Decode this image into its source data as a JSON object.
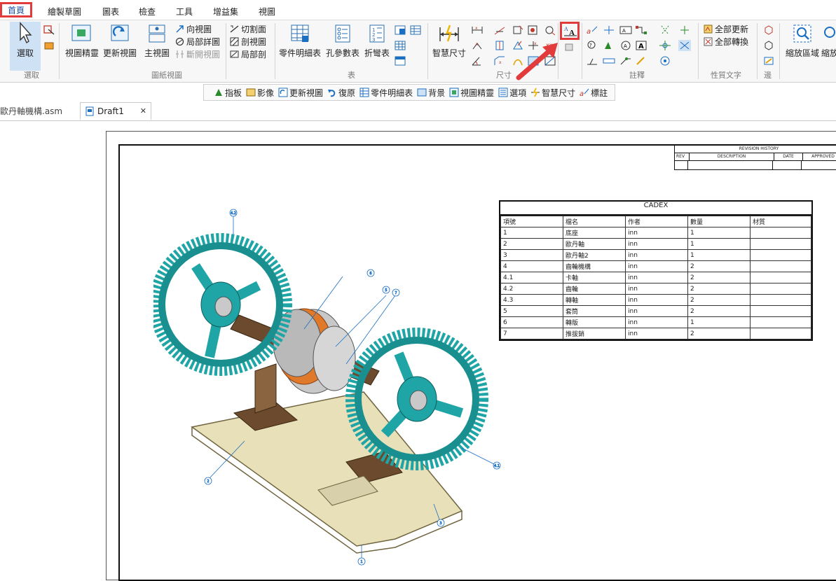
{
  "menu": {
    "tabs": [
      "首頁",
      "繪製草圖",
      "圖表",
      "檢查",
      "工具",
      "增益集",
      "視圖"
    ]
  },
  "ribbon": {
    "select": {
      "label": "選取",
      "group": "選取"
    },
    "drawing_views": {
      "view_wizard": "視圖精靈",
      "update_views": "更新視圖",
      "principal_view": "主視圖",
      "auxiliary_view": "向視圖",
      "detail_view": "局部詳圖",
      "broken_view": "斷開視圖",
      "section_line": "切割面",
      "section_view": "剖視圖",
      "broken_out": "局部剖",
      "group": "圖紙視圖"
    },
    "tables": {
      "parts_list": "零件明細表",
      "hole_table": "孔參數表",
      "bend_table": "折彎表",
      "group": "表"
    },
    "dimension": {
      "smart_dimension": "智慧尺寸",
      "group": "尺寸"
    },
    "annotation": {
      "group": "註釋"
    },
    "property_text": {
      "update_all": "全部更新",
      "convert_all": "全部轉換",
      "group": "性質文字"
    },
    "edges": {
      "group": "邊"
    },
    "zoom": {
      "zoom_area": "縮放區域",
      "zoom_more": "縮放"
    }
  },
  "quickbar": {
    "items": [
      "指板",
      "影像",
      "更新視圖",
      "復原",
      "零件明細表",
      "背景",
      "視圖精靈",
      "選項",
      "智慧尺寸",
      "標註"
    ]
  },
  "doctabs": {
    "asm": "歐丹軸機構.asm",
    "draft": "Draft1",
    "close": "✕"
  },
  "drawing": {
    "revision": {
      "title": "REVISION HISTORY",
      "cols": [
        "REV",
        "DESCRIPTION",
        "DATE",
        "APPROVED"
      ]
    },
    "bom": {
      "title": "CADEX",
      "headers": [
        "項號",
        "檔名",
        "作者",
        "數量",
        "材質"
      ],
      "rows": [
        [
          "1",
          "底座",
          "inn",
          "1",
          ""
        ],
        [
          "2",
          "歐丹軸",
          "inn",
          "1",
          ""
        ],
        [
          "3",
          "歐丹軸2",
          "inn",
          "1",
          ""
        ],
        [
          "4",
          "齒輪機構",
          "inn",
          "2",
          ""
        ],
        [
          "4.1",
          "卡軸",
          "inn",
          "2",
          ""
        ],
        [
          "4.2",
          "齒輪",
          "inn",
          "2",
          ""
        ],
        [
          "4.3",
          "轉軸",
          "inn",
          "2",
          ""
        ],
        [
          "5",
          "套筒",
          "inn",
          "2",
          ""
        ],
        [
          "6",
          "轉版",
          "inn",
          "1",
          ""
        ],
        [
          "7",
          "推拔銷",
          "inn",
          "2",
          ""
        ]
      ]
    },
    "balloons": [
      "4.2",
      "6",
      "5",
      "7",
      "2",
      "4.1",
      "3",
      "1"
    ]
  },
  "colors": {
    "accent": "#1b4fa0",
    "highlight": "#e23b3b",
    "gear": "#1fa5a5",
    "bronze": "#6b4a2e",
    "coupling": "#e07a2a",
    "base": "#e8e0b8"
  }
}
